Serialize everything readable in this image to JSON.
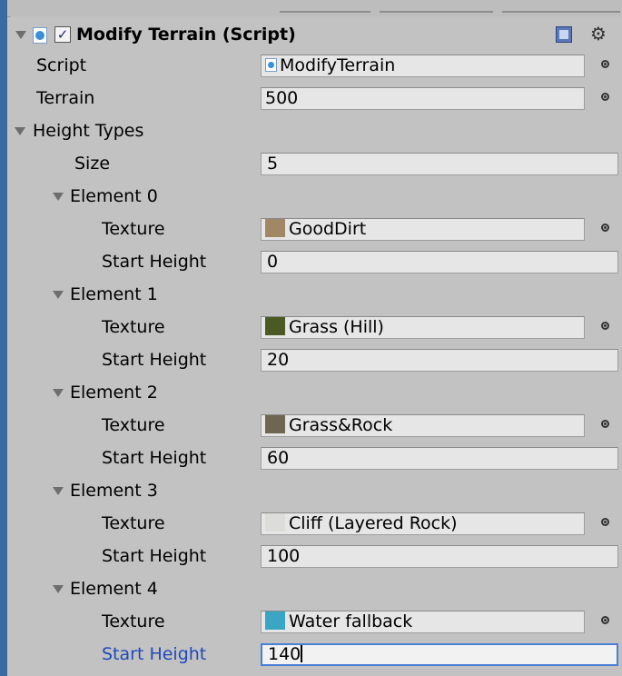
{
  "component": {
    "title": "Modify Terrain (Script)",
    "enabled_check": "✓"
  },
  "properties": {
    "script_label": "Script",
    "script_value": "ModifyTerrain",
    "terrain_label": "Terrain",
    "terrain_value": "500",
    "height_types_label": "Height Types",
    "size_label": "Size",
    "size_value": "5"
  },
  "labels": {
    "texture": "Texture",
    "start_height": "Start Height"
  },
  "elements": [
    {
      "name": "Element 0",
      "texture": "GoodDirt",
      "start_height": "0",
      "swatch_color": "#a08866"
    },
    {
      "name": "Element 1",
      "texture": "Grass (Hill)",
      "start_height": "20",
      "swatch_color": "#4b5a22"
    },
    {
      "name": "Element 2",
      "texture": "Grass&Rock",
      "start_height": "60",
      "swatch_color": "#6e6650"
    },
    {
      "name": "Element 3",
      "texture": "Cliff (Layered Rock)",
      "start_height": "100",
      "swatch_color": "#dcdcd8"
    },
    {
      "name": "Element 4",
      "texture": "Water fallback",
      "start_height": "140",
      "swatch_color": "#3aa6c4"
    }
  ],
  "colors": {
    "panel_bg": "#c2c2c2",
    "active_label": "#1f49b8",
    "focus_border": "#4a7fd6"
  },
  "icons": {
    "fold": "triangle-down-icon",
    "script": "csharp-script-icon",
    "help": "help-book-icon",
    "settings": "gear-icon",
    "object_picker": "object-picker-icon"
  }
}
